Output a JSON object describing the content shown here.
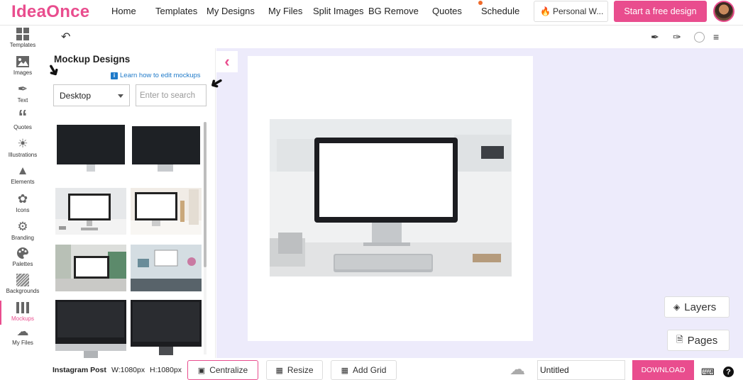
{
  "app": {
    "logo_text": "IdeaOnce",
    "brand_color": "#e94d8e"
  },
  "nav": {
    "items": [
      "Home",
      "Templates",
      "My Designs",
      "My Files",
      "Split Images",
      "BG Remove",
      "Quotes",
      "Schedule"
    ],
    "personal_label": "Personal W...",
    "cta_label": "Start a free design"
  },
  "sidebar": {
    "items": [
      {
        "label": "Templates",
        "icon": "grid-icon"
      },
      {
        "label": "Images",
        "icon": "image-icon"
      },
      {
        "label": "Text",
        "icon": "pen-icon"
      },
      {
        "label": "Quotes",
        "icon": "quote-icon"
      },
      {
        "label": "Illustrations",
        "icon": "illustration-icon"
      },
      {
        "label": "Elements",
        "icon": "elements-icon"
      },
      {
        "label": "Icons",
        "icon": "leaf-icon"
      },
      {
        "label": "Branding",
        "icon": "gear-icon"
      },
      {
        "label": "Palettes",
        "icon": "palette-icon"
      },
      {
        "label": "Backgrounds",
        "icon": "pattern-icon"
      },
      {
        "label": "Mockups",
        "icon": "mockup-icon"
      },
      {
        "label": "My Files",
        "icon": "cloud-files-icon"
      }
    ],
    "active": "Mockups"
  },
  "panel": {
    "title": "Mockup Designs",
    "learn_link": "Learn how to edit mockups",
    "device_select": "Desktop",
    "search_placeholder": "Enter to search"
  },
  "workspace": {
    "layers_label": "Layers",
    "pages_label": "Pages"
  },
  "bottom": {
    "format_label": "Instagram Post",
    "width_label": "W:1080px",
    "height_label": "H:1080px",
    "centralize_label": "Centralize",
    "resize_label": "Resize",
    "add_grid_label": "Add Grid",
    "title_value": "Untitled",
    "download_label": "DOWNLOAD"
  }
}
